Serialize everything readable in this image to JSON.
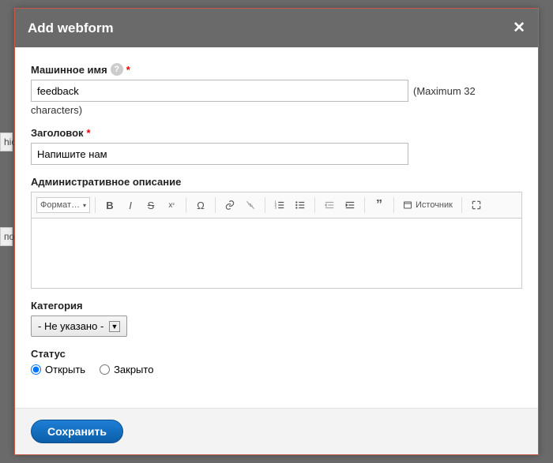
{
  "modal": {
    "title": "Add webform",
    "close": "✕"
  },
  "fields": {
    "machine_name": {
      "label": "Машинное имя",
      "value": "feedback",
      "hint_inline": "(Maximum 32",
      "hint_below": "characters)"
    },
    "title": {
      "label": "Заголовок",
      "value": "Напишите нам"
    },
    "description": {
      "label": "Административное описание"
    },
    "category": {
      "label": "Категория",
      "selected": "- Не указано -"
    },
    "status": {
      "label": "Статус",
      "open": "Открыть",
      "closed": "Закрыто"
    }
  },
  "toolbar": {
    "format": "Формат…",
    "source": "Источник"
  },
  "footer": {
    "save": "Сохранить"
  },
  "bg": {
    "left1": "hic",
    "left2": "по"
  }
}
